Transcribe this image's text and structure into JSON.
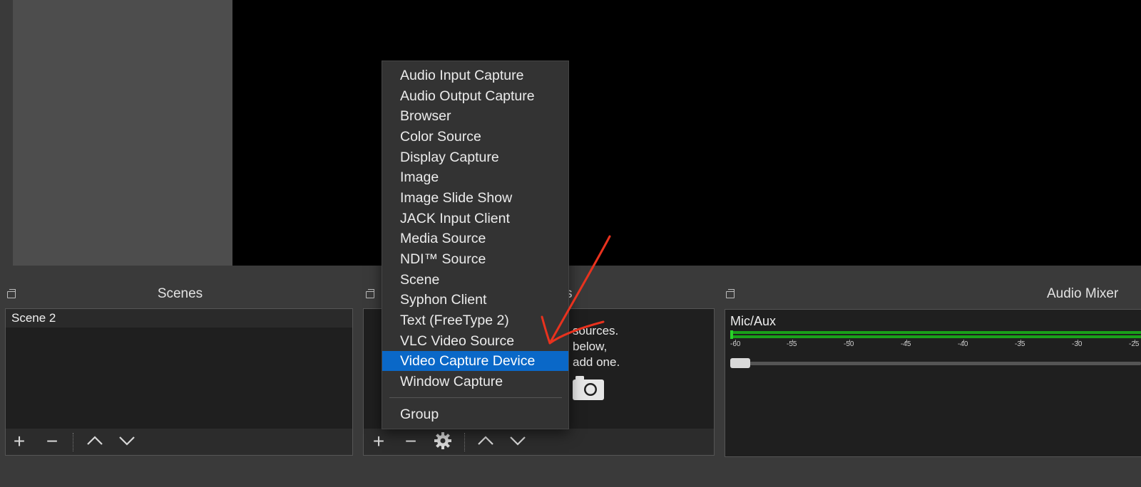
{
  "docks": {
    "scenes": {
      "title": "Scenes",
      "items": [
        "Scene 2"
      ]
    },
    "sources": {
      "title_visible_fragment": "s",
      "empty_hint_lines": [
        "sources.",
        "below,",
        "add one."
      ]
    },
    "audio_mixer": {
      "title": "Audio Mixer",
      "channel_name": "Mic/Aux",
      "scale_labels": [
        "-60",
        "-55",
        "-50",
        "-45",
        "-40",
        "-35",
        "-30",
        "-25"
      ]
    }
  },
  "toolbar_icons": {
    "add": "+",
    "remove": "−",
    "up": "chevron-up-icon",
    "down": "chevron-down-icon",
    "settings": "gear-icon"
  },
  "context_menu": {
    "items": [
      "Audio Input Capture",
      "Audio Output Capture",
      "Browser",
      "Color Source",
      "Display Capture",
      "Image",
      "Image Slide Show",
      "JACK Input Client",
      "Media Source",
      "NDI™ Source",
      "Scene",
      "Syphon Client",
      "Text (FreeType 2)",
      "VLC Video Source",
      "Video Capture Device",
      "Window Capture"
    ],
    "selected": "Video Capture Device",
    "group_item": "Group"
  },
  "colors": {
    "selection": "#0a68c8",
    "annotation_arrow": "#e8321e",
    "meter_green": "#1aa01a"
  }
}
